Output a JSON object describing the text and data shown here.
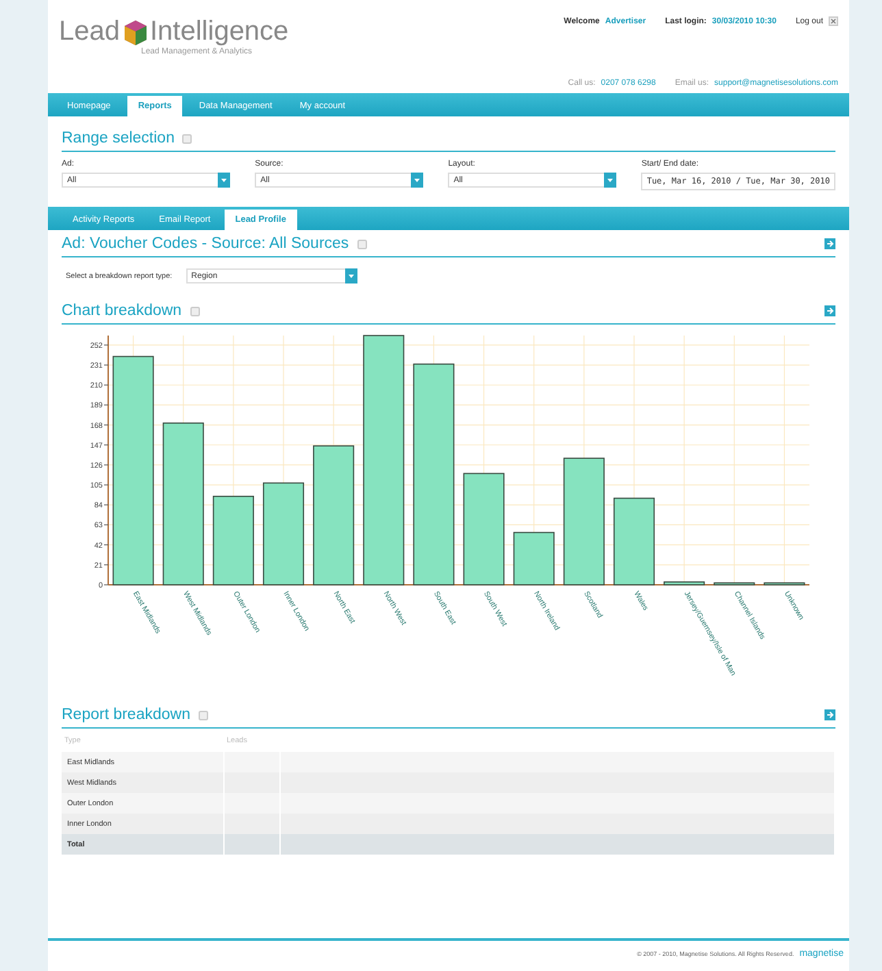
{
  "header": {
    "logo_left": "Lead",
    "logo_right": "Intelligence",
    "tagline": "Lead Management & Analytics",
    "welcome_label": "Welcome",
    "user": "Advertiser",
    "last_login_label": "Last login:",
    "last_login": "30/03/2010 10:30",
    "logout": "Log out",
    "call_label": "Call us:",
    "phone": "0207 078 6298",
    "email_label": "Email us:",
    "email": "support@magnetisesolutions.com"
  },
  "nav": [
    {
      "label": "Homepage",
      "selected": false
    },
    {
      "label": "Reports",
      "selected": true
    },
    {
      "label": "Data Management",
      "selected": false
    },
    {
      "label": "My account",
      "selected": false
    }
  ],
  "range": {
    "title": "Range selection",
    "filters": [
      {
        "kind": "select",
        "label": "Ad:",
        "value": "All"
      },
      {
        "kind": "select",
        "label": "Source:",
        "value": "All"
      },
      {
        "kind": "select",
        "label": "Layout:",
        "value": "All"
      },
      {
        "kind": "date",
        "label": "Start/ End date:",
        "value": "Tue, Mar 16, 2010  /  Tue, Mar 30, 2010"
      }
    ]
  },
  "report_tabs": [
    {
      "label": "Activity Reports",
      "selected": false
    },
    {
      "label": "Email Report",
      "selected": false
    },
    {
      "label": "Lead Profile",
      "selected": true
    }
  ],
  "report": {
    "title": "Ad: Voucher Codes -  Source:  All Sources",
    "breakdown_label": "Select a breakdown report type:",
    "breakdown_value": "Region"
  },
  "chart": {
    "title": "Chart breakdown",
    "chart_data": {
      "type": "bar",
      "categories": [
        "East Midlands",
        "West Midlands",
        "Outer London",
        "Inner London",
        "North East",
        "North West",
        "South East",
        "South West",
        "North Ireland",
        "Scotland",
        "Wales",
        "Jersey/Guernsey/Isle of Man",
        "Channel Islands",
        "Unknown"
      ],
      "values": [
        240,
        170,
        93,
        107,
        146,
        262,
        232,
        117,
        55,
        133,
        91,
        3,
        2,
        2
      ],
      "ylim": [
        0,
        262
      ],
      "grid": true,
      "yticks": [
        0,
        21,
        42,
        63,
        84,
        105,
        126,
        147,
        168,
        189,
        210,
        231,
        252
      ]
    }
  },
  "table": {
    "title": "Report breakdown",
    "columns": [
      "Type",
      "Leads"
    ],
    "rows": [
      {
        "type": "East Midlands",
        "total": false
      },
      {
        "type": "West Midlands",
        "total": false
      },
      {
        "type": "Outer London",
        "total": false
      },
      {
        "type": "Inner London",
        "total": false
      },
      {
        "type": "Total",
        "total": true
      }
    ]
  },
  "footer": {
    "copyright": "© 2007 - 2010, Magnetise Solutions. All Rights Reserved.",
    "brand": "magnetise"
  }
}
